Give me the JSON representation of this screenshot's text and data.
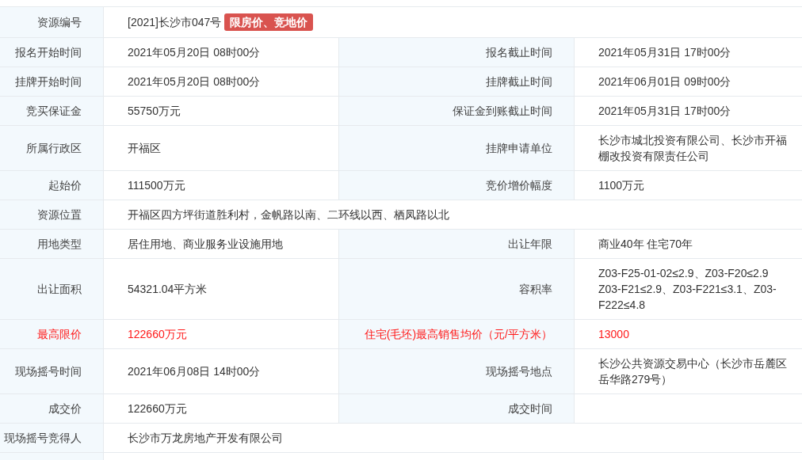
{
  "rows": [
    {
      "kind": "wide",
      "highlight": false,
      "label": "资源编号",
      "value": "[2021]长沙市047号",
      "tag": "限房价、竞地价"
    },
    {
      "kind": "pair",
      "highlight": false,
      "cells": [
        {
          "label": "报名开始时间",
          "value": "2021年05月20日 08时00分"
        },
        {
          "label": "报名截止时间",
          "value": "2021年05月31日 17时00分"
        }
      ]
    },
    {
      "kind": "pair",
      "highlight": false,
      "cells": [
        {
          "label": "挂牌开始时间",
          "value": "2021年05月20日 08时00分"
        },
        {
          "label": "挂牌截止时间",
          "value": "2021年06月01日 09时00分"
        }
      ]
    },
    {
      "kind": "pair",
      "highlight": false,
      "cells": [
        {
          "label": "竞买保证金",
          "value": "55750万元"
        },
        {
          "label": "保证金到账截止时间",
          "value": "2021年05月31日 17时00分"
        }
      ]
    },
    {
      "kind": "pair",
      "highlight": false,
      "cells": [
        {
          "label": "所属行政区",
          "value": "开福区"
        },
        {
          "label": "挂牌申请单位",
          "value": "长沙市城北投资有限公司、长沙市开福棚改投资有限责任公司"
        }
      ]
    },
    {
      "kind": "pair",
      "highlight": false,
      "cells": [
        {
          "label": "起始价",
          "value": "111500万元"
        },
        {
          "label": "竞价增价幅度",
          "value": "1100万元"
        }
      ]
    },
    {
      "kind": "wide",
      "highlight": false,
      "label": "资源位置",
      "value": "开福区四方坪街道胜利村，金帆路以南、二环线以西、栖凤路以北"
    },
    {
      "kind": "pair",
      "highlight": false,
      "cells": [
        {
          "label": "用地类型",
          "value": "居住用地、商业服务业设施用地"
        },
        {
          "label": "出让年限",
          "value": "商业40年 住宅70年"
        }
      ]
    },
    {
      "kind": "pair",
      "highlight": false,
      "cells": [
        {
          "label": "出让面积",
          "value": "54321.04平方米"
        },
        {
          "label": "容积率",
          "value": "Z03-F25-01-02≤2.9、Z03-F20≤2.9 Z03-F21≤2.9、Z03-F221≤3.1、Z03-F222≤4.8"
        }
      ]
    },
    {
      "kind": "pair",
      "highlight": true,
      "cells": [
        {
          "label": "最高限价",
          "value": "122660万元"
        },
        {
          "label": "住宅(毛坯)最高销售均价（元/平方米）",
          "value": "13000"
        }
      ]
    },
    {
      "kind": "pair",
      "highlight": false,
      "cells": [
        {
          "label": "现场摇号时间",
          "value": "2021年06月08日 14时00分"
        },
        {
          "label": "现场摇号地点",
          "value": "长沙公共资源交易中心（长沙市岳麓区岳华路279号）"
        }
      ]
    },
    {
      "kind": "pair",
      "highlight": false,
      "cells": [
        {
          "label": "成交价",
          "value": "122660万元"
        },
        {
          "label": "成交时间"
        }
      ]
    },
    {
      "kind": "wide",
      "highlight": false,
      "label": "现场摇号竞得人",
      "value": "长沙市万龙房地产开发有限公司"
    }
  ]
}
